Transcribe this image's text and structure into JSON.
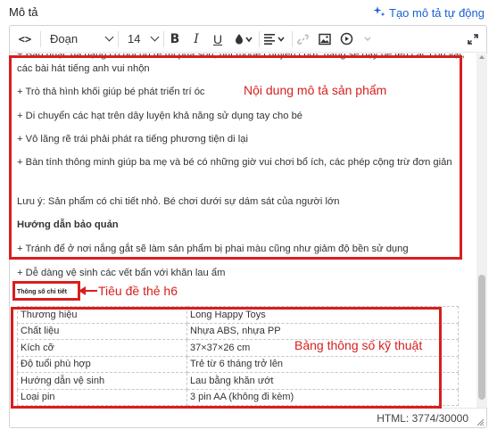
{
  "field": {
    "label": "Mô tả",
    "ai_link": "Tạo mô tả tự động",
    "ai_icon": "sparkle-icon"
  },
  "toolbar": {
    "code_label": "<>",
    "paragraph_label": "Đoạn",
    "size_label": "14",
    "bold_label": "B",
    "italic_label": "I",
    "underline_label": "U",
    "icons": [
      "code-icon",
      "bold-icon",
      "italic-icon",
      "underline-icon",
      "text-color-icon",
      "align-icon",
      "link-icon",
      "image-icon",
      "video-icon",
      "fullscreen-icon"
    ]
  },
  "content": {
    "lines": [
      "+ Bản nhạc đa dạng có nốt đô rê mi pha son, nút mode chuyển chức năng sẽ dạy bé tên các con vật, các bài hát tiếng anh vui nhộn",
      "+ Trò thả hình khối giúp bé phát triển trí óc",
      "+ Di chuyển các hạt trên dây luyện khả năng sử dụng tay cho bé",
      "+ Vô lăng rẽ trái phải phát ra tiếng phương tiện di lại",
      "+ Bàn tính thông minh giúp ba mẹ và bé có những giờ vui chơi bổ ích, các phép cộng trừ đơn giản",
      "Lưu ý: Sản phẩm có chi tiết nhỏ. Bé chơi dưới sự dám sát của người lớn",
      "Hướng dẫn bảo quản",
      "+ Tránh để ở nơi nắng gắt sẽ làm sản phẩm bị phai màu cũng như giảm độ bền sử dụng",
      "+ Dễ dàng vệ sinh các vết bẩn với khăn lau ẩm"
    ],
    "heading_h6": "Thông số chi tiết",
    "spec_rows": [
      {
        "key": "Thương hiệu",
        "value": "Long Happy Toys"
      },
      {
        "key": "Chất liệu",
        "value": "Nhựa ABS, nhựa PP"
      },
      {
        "key": "Kích cỡ",
        "value": "37×37×26 cm"
      },
      {
        "key": "Độ tuổi phù hợp",
        "value": "Trẻ từ 6 tháng trở lên"
      },
      {
        "key": "Hướng dẫn vệ sinh",
        "value": "Lau bằng khăn ướt"
      },
      {
        "key": "Loại pin",
        "value": "3 pin AA (không đi kèm)"
      }
    ]
  },
  "status": {
    "char_count": "HTML: 3774/30000"
  },
  "annotations": {
    "description_label": "Nội dung mô tả sản phẩm",
    "heading_label": "Tiêu đề thẻ h6",
    "table_label": "Bảng thông số kỹ thuật",
    "color": "#d81e1e"
  }
}
